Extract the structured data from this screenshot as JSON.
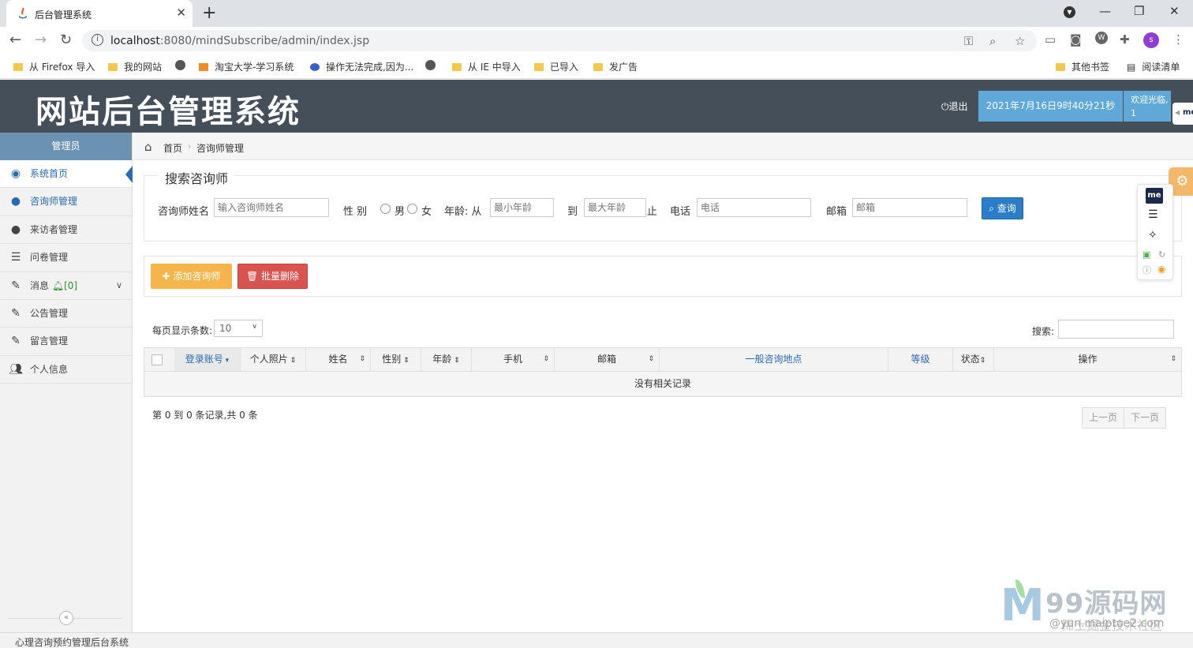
{
  "browser": {
    "tab_title": "后台管理系统",
    "url_host": "localhost",
    "url_rest": ":8080/mindSubscribe/admin/index.jsp",
    "avatar_letter": "s",
    "bookmarks": [
      "从 Firefox 导入",
      "我的网站",
      "淘宝大学-学习系统",
      "操作无法完成,因为...",
      "从 IE 中导入",
      "已导入",
      "发广告"
    ],
    "bookmarks_right": [
      "其他书签",
      "阅读清单"
    ]
  },
  "header": {
    "title": "网站后台管理系统",
    "logout": "退出",
    "datetime": "2021年7月16日9时40分21秒",
    "welcome_line1": "欢迎光临,",
    "welcome_line2": "1",
    "me_tab": "me"
  },
  "sidebar": {
    "role": "管理员",
    "items": [
      {
        "label": "系统首页",
        "icon": "dashboard-icon"
      },
      {
        "label": "咨询师管理",
        "icon": "user-icon"
      },
      {
        "label": "来访者管理",
        "icon": "user-icon"
      },
      {
        "label": "问卷管理",
        "icon": "list-icon"
      },
      {
        "label": "消息",
        "icon": "edit-icon",
        "badge": "[0]"
      },
      {
        "label": "公告管理",
        "icon": "edit-icon"
      },
      {
        "label": "留言管理",
        "icon": "edit-icon"
      },
      {
        "label": "个人信息",
        "icon": "users-icon"
      }
    ]
  },
  "breadcrumb": {
    "home": "首页",
    "current": "咨询师管理"
  },
  "search": {
    "legend": "搜索咨询师",
    "name_label": "咨询师姓名",
    "name_placeholder": "输入咨询师姓名",
    "gender_label": "性 别",
    "male": "男",
    "female": "女",
    "age_label": "年龄: 从",
    "age_min_placeholder": "最小年龄",
    "to_label": "到",
    "age_max_placeholder": "最大年龄",
    "end_label": "止",
    "phone_label": "电话",
    "phone_placeholder": "电话",
    "email_label": "邮箱",
    "email_placeholder": "邮箱",
    "query_button": "查询"
  },
  "toolbar": {
    "add": "添加咨询师",
    "delete": "批量删除"
  },
  "table": {
    "page_size_label": "每页显示条数:",
    "page_size": "10",
    "search_label": "搜索:",
    "columns": [
      "登录账号",
      "个人照片",
      "姓名",
      "性别",
      "年龄",
      "手机",
      "邮箱",
      "一般咨询地点",
      "等级",
      "状态",
      "操作"
    ],
    "empty_text": "没有相关记录",
    "records_text": "第 0 到 0 条记录,共 0 条",
    "prev": "上一页",
    "next": "下一页"
  },
  "floating_panel": {
    "me": "me"
  },
  "watermark": {
    "text": "99源码网",
    "sub": "稀土掘金技术社区",
    "url": "@yun.maiptoe2.com"
  },
  "footer": {
    "text": "心理咨询预约管理后台系统"
  },
  "colors": {
    "header_bg": "#444f5a",
    "sidebar_head": "#6b92b3",
    "accent_blue": "#2a7dc9",
    "add_btn": "#f5b54a",
    "delete_btn": "#d9534f",
    "datetime_bg": "#5fa8d8"
  }
}
